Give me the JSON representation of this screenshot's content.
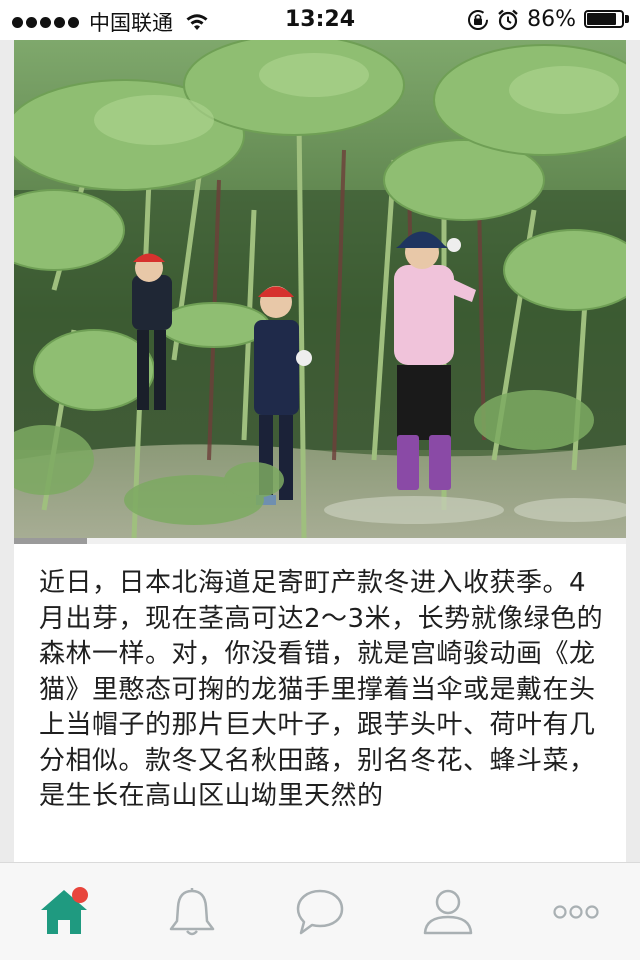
{
  "status_bar": {
    "carrier": "中国联通",
    "time": "13:24",
    "battery_percent": "86%",
    "battery_level": 0.86,
    "icons": [
      "signal-dots-icon",
      "wifi-icon",
      "rotation-lock-icon",
      "alarm-icon",
      "battery-icon"
    ]
  },
  "article": {
    "image_icon": "photo-children-under-giant-butterbur-leaves",
    "image_progress": 0.12,
    "text": "近日，日本北海道足寄町产款冬进入收获季。4月出芽，现在茎高可达2～3米，长势就像绿色的森林一样。对，你没看错，就是宫崎骏动画《龙猫》里憨态可掬的龙猫手里撑着当伞或是戴在头上当帽子的那片巨大叶子，跟芋头叶、荷叶有几分相似。款冬又名秋田蕗，别名冬花、蜂斗菜，是生长在高山区山坳里天然的"
  },
  "tab_bar": {
    "accent_color": "#1f9a80",
    "badge_color": "#e8453c",
    "inactive_color": "#a9b0b3",
    "tabs": [
      {
        "icon": "home-icon",
        "active": true,
        "has_badge": true
      },
      {
        "icon": "bell-icon",
        "active": false
      },
      {
        "icon": "chat-bubble-icon",
        "active": false
      },
      {
        "icon": "profile-icon",
        "active": false
      },
      {
        "icon": "more-dots-icon",
        "active": false
      }
    ]
  }
}
